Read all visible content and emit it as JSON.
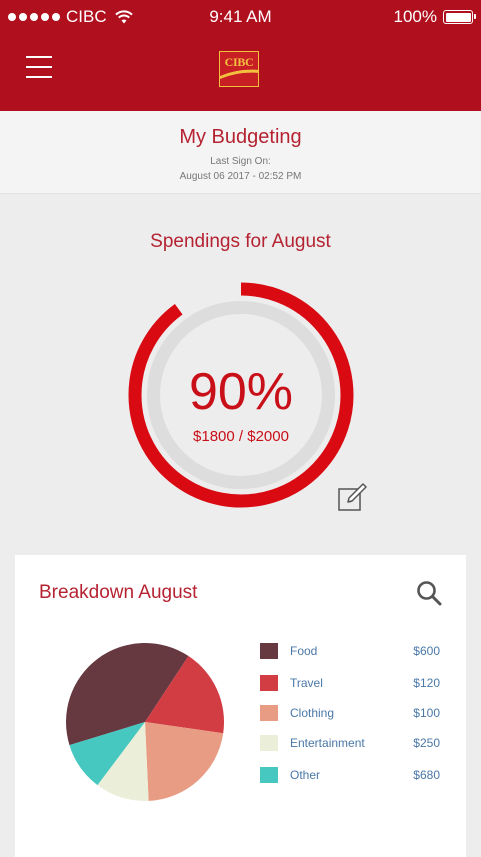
{
  "status_bar": {
    "carrier": "CIBC",
    "time": "9:41 AM",
    "battery": "100%",
    "battery_level": 1.0
  },
  "header": {
    "logo_text": "CIBC",
    "brand_color": "#b0101e"
  },
  "subheader": {
    "title": "My Budgeting",
    "last_sign_on_label": "Last Sign On:",
    "last_sign_on_date": "August 06 2017 - 02:52 PM"
  },
  "spending": {
    "title": "Spendings for August",
    "percent_text": "90%",
    "amount_text": "$1800 / $2000",
    "progress": 0.9,
    "ring_color": "#d90a12",
    "track_color": "#dddddd"
  },
  "breakdown": {
    "title": "Breakdown August",
    "items": [
      {
        "label": "Food",
        "value": "$600",
        "color": "#663840"
      },
      {
        "label": "Travel",
        "value": "$120",
        "color": "#d23c43"
      },
      {
        "label": "Clothing",
        "value": "$100",
        "color": "#e89c84"
      },
      {
        "label": "Entertainment",
        "value": "$250",
        "color": "#ebefda"
      },
      {
        "label": "Other",
        "value": "$680",
        "color": "#46c7c0"
      }
    ]
  },
  "chart_data": {
    "type": "pie",
    "categories": [
      "Food",
      "Travel",
      "Clothing",
      "Entertainment",
      "Other"
    ],
    "slices": [
      {
        "label": "Food",
        "fraction": 0.39,
        "color": "#663840"
      },
      {
        "label": "Travel",
        "fraction": 0.18,
        "color": "#d23c43"
      },
      {
        "label": "Clothing",
        "fraction": 0.22,
        "color": "#e89c84"
      },
      {
        "label": "Entertainment",
        "fraction": 0.11,
        "color": "#ebefda"
      },
      {
        "label": "Other",
        "fraction": 0.1,
        "color": "#46c7c0"
      }
    ]
  }
}
